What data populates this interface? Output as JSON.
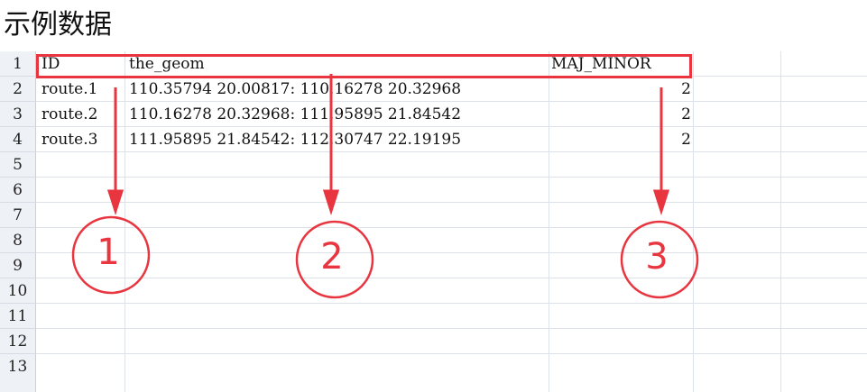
{
  "title": "示例数据",
  "row_numbers": [
    "1",
    "2",
    "3",
    "4",
    "5",
    "6",
    "7",
    "8",
    "9",
    "10",
    "11",
    "12",
    "13"
  ],
  "columns": [
    "ID",
    "the_geom",
    "MAJ_MINOR"
  ],
  "rows": [
    {
      "id": "route.1",
      "geom": "110.35794 20.00817: 110.16278 20.32968",
      "maj_minor": "2"
    },
    {
      "id": "route.2",
      "geom": "110.16278 20.32968: 111.95895 21.84542",
      "maj_minor": "2"
    },
    {
      "id": "route.3",
      "geom": "111.95895 21.84542: 112.30747 22.19195",
      "maj_minor": "2"
    }
  ],
  "annotations": [
    "1",
    "2",
    "3"
  ],
  "colors": {
    "annotation_red": "#e8353f",
    "row_header_bg": "#eef1f6",
    "grid": "#dde1e8"
  }
}
